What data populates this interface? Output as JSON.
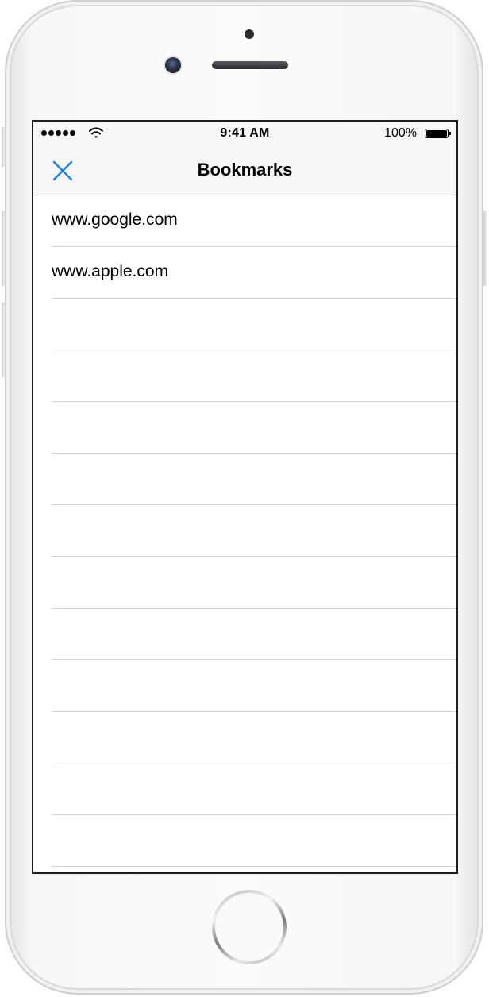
{
  "status_bar": {
    "time": "9:41 AM",
    "battery_percent": "100%",
    "battery_level": 1.0
  },
  "navbar": {
    "title": "Bookmarks",
    "close_icon": "close-icon",
    "accent_color": "#1a7ee8"
  },
  "bookmarks": [
    {
      "label": "www.google.com"
    },
    {
      "label": "www.apple.com"
    },
    {
      "label": ""
    },
    {
      "label": ""
    },
    {
      "label": ""
    },
    {
      "label": ""
    },
    {
      "label": ""
    },
    {
      "label": ""
    },
    {
      "label": ""
    },
    {
      "label": ""
    },
    {
      "label": ""
    },
    {
      "label": ""
    },
    {
      "label": ""
    }
  ]
}
